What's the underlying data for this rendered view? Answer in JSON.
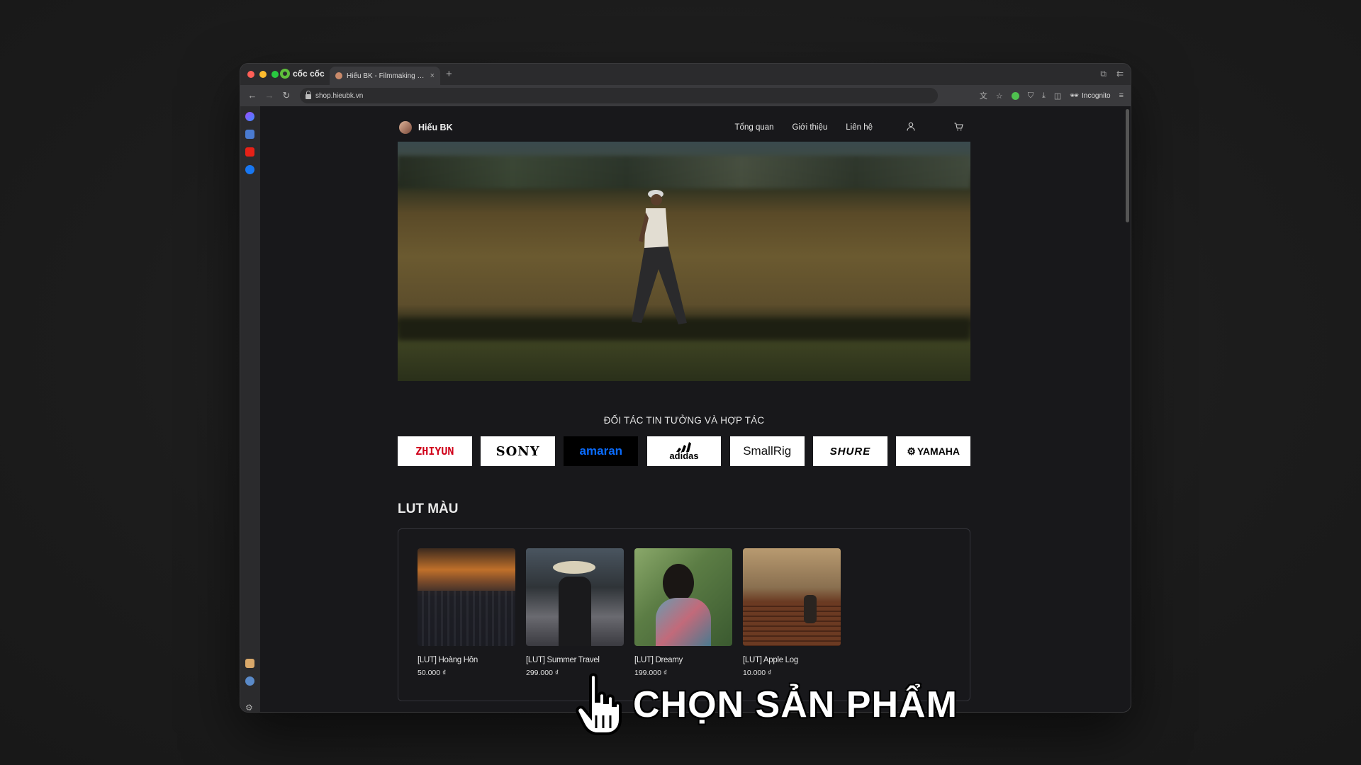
{
  "browser": {
    "brand": "cốc cốc",
    "tab_title": "Hiếu BK - Filmmaking Store",
    "tab_close": "×",
    "new_tab": "+",
    "url": "shop.hieubk.vn",
    "incognito_label": "Incognito"
  },
  "site": {
    "name": "Hiếu BK",
    "menu": [
      "Tổng quan",
      "Giới thiệu",
      "Liên hệ"
    ],
    "partners_title": "ĐỐI TÁC TIN TƯỞNG VÀ HỢP TÁC",
    "partners": [
      {
        "name": "ZHIYUN",
        "color": "#d0021b",
        "bg": "#ffffff"
      },
      {
        "name": "SONY",
        "color": "#000000",
        "bg": "#ffffff"
      },
      {
        "name": "amaran",
        "color": "#0a6cff",
        "bg": "#000000"
      },
      {
        "name": "adidas",
        "color": "#000000",
        "bg": "#ffffff"
      },
      {
        "name": "SmallRig",
        "color": "#111111",
        "bg": "#ffffff"
      },
      {
        "name": "SHURE",
        "color": "#000000",
        "bg": "#ffffff"
      },
      {
        "name": "YAMAHA",
        "color": "#000000",
        "bg": "#ffffff"
      }
    ],
    "section_title": "LUT MÀU",
    "products": [
      {
        "name": "[LUT] Hoàng Hôn",
        "price": "50.000 ₫"
      },
      {
        "name": "[LUT] Summer Travel",
        "price": "299.000 ₫"
      },
      {
        "name": "[LUT] Dreamy",
        "price": "199.000 ₫"
      },
      {
        "name": "[LUT] Apple Log",
        "price": "10.000 ₫"
      }
    ]
  },
  "overlay": {
    "caption": "CHỌN SẢN PHẨM"
  },
  "colors": {
    "page_bg": "#18181b",
    "traffic_red": "#ff5f57",
    "traffic_yellow": "#febc2e",
    "traffic_green": "#28c840"
  }
}
